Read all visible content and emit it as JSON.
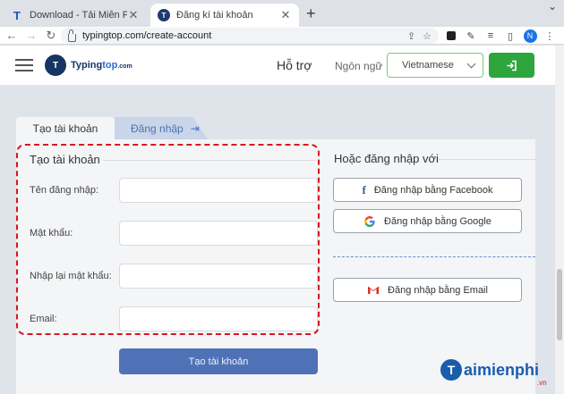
{
  "browser": {
    "tabs": [
      {
        "title": "Download - Tải Miễn Phí VN - Ph",
        "favicon": "T",
        "active": false
      },
      {
        "title": "Đăng kí tài khoản",
        "favicon": "T",
        "active": true
      }
    ],
    "new_tab": "+",
    "window_controls": "⌄",
    "url": "typingtop.com/create-account",
    "profile_initial": "N"
  },
  "header": {
    "logo_mark": "T",
    "logo_name": "Typing",
    "logo_accent": "top",
    "logo_suffix": ".com",
    "support": "Hỗ trợ",
    "language_label": "Ngôn ngữ",
    "language_selected": "Vietnamese",
    "login_icon": "login-icon"
  },
  "form_tabs": {
    "register": "Tạo tài khoản",
    "login": "Đăng nhập"
  },
  "form": {
    "title": "Tạo tài khoản",
    "fields": [
      {
        "label": "Tên đăng nhập:",
        "value": ""
      },
      {
        "label": "Mật khẩu:",
        "value": ""
      },
      {
        "label": "Nhập lại mật khẩu:",
        "value": ""
      },
      {
        "label": "Email:",
        "value": ""
      }
    ],
    "submit": "Tạo tài khoản"
  },
  "alt_login": {
    "title": "Hoặc đăng nhập với",
    "facebook": "Đăng nhập bằng Facebook",
    "google": "Đăng nhập bằng Google",
    "email": "Đăng nhập bằng Email"
  },
  "watermark": {
    "mark": "T",
    "text": "aimienphi",
    "suffix": ".vn"
  },
  "colors": {
    "accent_green": "#2fa53e",
    "accent_blue": "#4f72b6",
    "highlight_red": "#d6191f"
  }
}
